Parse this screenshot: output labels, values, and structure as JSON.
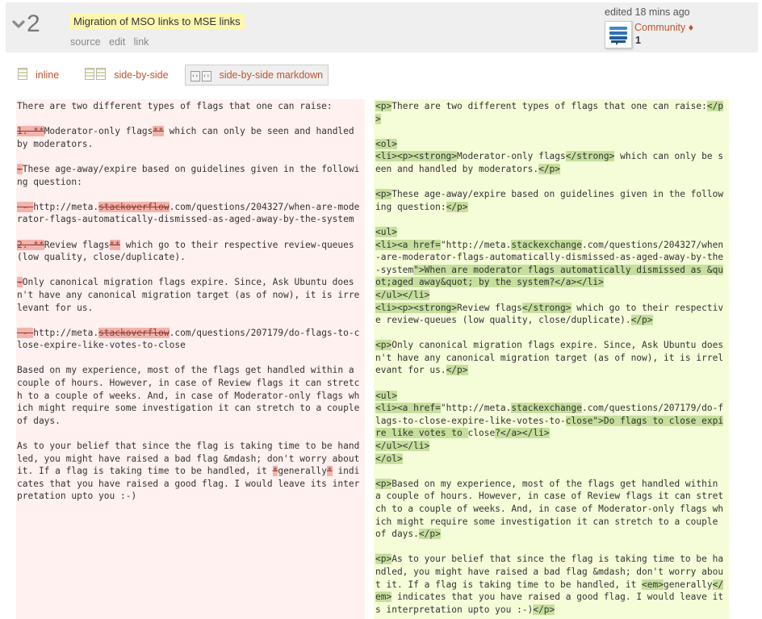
{
  "revision": {
    "number": "2",
    "title": "Migration of MSO links to MSE links",
    "links": [
      "source",
      "edit",
      "link"
    ]
  },
  "editor": {
    "edited_text": "edited 18 mins ago",
    "name": "Community",
    "diamond": "♦",
    "reputation": "1"
  },
  "tabs": [
    "inline",
    "side-by-side",
    "side-by-side markdown"
  ],
  "colors": {
    "link": "#c0532c",
    "deleted_bg": "#f3b3ab",
    "inserted_bg": "#c6df9d",
    "left_pane": "#fff1ef",
    "right_pane": "#f5fcd8"
  },
  "left_pane": [
    {
      "t": "There are two different types of flags that one can raise:\n\n"
    },
    {
      "t": "1. **",
      "c": "del"
    },
    {
      "t": "Moderator-only flags"
    },
    {
      "t": "**",
      "c": "del"
    },
    {
      "t": " which can only be seen and handled by moderators.\n\n"
    },
    {
      "t": "-",
      "c": "del"
    },
    {
      "t": "These age-away/expire based on guidelines given in the following question:\n\n"
    },
    {
      "t": " - ",
      "c": "del"
    },
    {
      "t": "http://meta."
    },
    {
      "t": "stackoverflow",
      "c": "del"
    },
    {
      "t": ".com/questions/204327/when-are-moderator-flags-automatically-dismissed-as-aged-away-by-the-system\n\n"
    },
    {
      "t": "2. **",
      "c": "del"
    },
    {
      "t": "Review flags"
    },
    {
      "t": "**",
      "c": "del"
    },
    {
      "t": " which go to their respective review-queues (low quality, close/duplicate).\n\n"
    },
    {
      "t": "-",
      "c": "del"
    },
    {
      "t": "Only canonical migration flags expire. Since, Ask Ubuntu doesn't have any canonical migration target (as of now), it is irrelevant for us.\n\n"
    },
    {
      "t": " - ",
      "c": "del"
    },
    {
      "t": "http://meta."
    },
    {
      "t": "stackoverflow",
      "c": "del"
    },
    {
      "t": ".com/questions/207179/do-flags-to-close-expire-like-votes-to-close\n\nBased on my experience, most of the flags get handled within a couple of hours. However, in case of Review flags it can stretch to a couple of weeks. And, in case of Moderator-only flags which might require some investigation it can stretch to a couple of days.\n\nAs to your belief that since the flag is taking time to be handled, you might have raised a bad flag &mdash; don't worry about it. If a flag is taking time to be handled, it "
    },
    {
      "t": "*",
      "c": "del"
    },
    {
      "t": "generally"
    },
    {
      "t": "*",
      "c": "del"
    },
    {
      "t": " indicates that you have raised a good flag. I would leave its interpretation upto you :-)"
    }
  ],
  "right_pane": [
    {
      "t": "<p>",
      "c": "ins"
    },
    {
      "t": "There are two different types of flags that one can raise:"
    },
    {
      "t": "</p>",
      "c": "ins"
    },
    {
      "t": "\n\n"
    },
    {
      "t": "<ol>",
      "c": "ins"
    },
    {
      "t": "\n"
    },
    {
      "t": "<li><p><strong>",
      "c": "ins"
    },
    {
      "t": "Moderator-only flags"
    },
    {
      "t": "</strong>",
      "c": "ins"
    },
    {
      "t": " which can only be seen and handled by moderators."
    },
    {
      "t": "</p>",
      "c": "ins"
    },
    {
      "t": "\n\n"
    },
    {
      "t": "<p>",
      "c": "ins"
    },
    {
      "t": "These age-away/expire based on guidelines given in the following question:"
    },
    {
      "t": "</p>",
      "c": "ins"
    },
    {
      "t": "\n\n"
    },
    {
      "t": "<ul>",
      "c": "ins"
    },
    {
      "t": "\n"
    },
    {
      "t": "<li><a href=",
      "c": "ins"
    },
    {
      "t": "\"http://meta."
    },
    {
      "t": "stackexchange",
      "c": "ins"
    },
    {
      "t": ".com/questions/204327/when-are-moderator-flags-automatically-dismissed-as-aged-away-by-the-system"
    },
    {
      "t": "\">When are moderator flags automatically dismissed as &quot;aged away&quot; by the system?</a></li>",
      "c": "ins"
    },
    {
      "t": "\n"
    },
    {
      "t": "</ul></li>",
      "c": "ins"
    },
    {
      "t": "\n"
    },
    {
      "t": "<li><p><strong>",
      "c": "ins"
    },
    {
      "t": "Review flags"
    },
    {
      "t": "</strong>",
      "c": "ins"
    },
    {
      "t": " which go to their respective review-queues (low quality, close/duplicate)."
    },
    {
      "t": "</p>",
      "c": "ins"
    },
    {
      "t": "\n\n"
    },
    {
      "t": "<p>",
      "c": "ins"
    },
    {
      "t": "Only canonical migration flags expire. Since, Ask Ubuntu doesn't have any canonical migration target (as of now), it is irrelevant for us."
    },
    {
      "t": "</p>",
      "c": "ins"
    },
    {
      "t": "\n\n"
    },
    {
      "t": "<ul>",
      "c": "ins"
    },
    {
      "t": "\n"
    },
    {
      "t": "<li><a href=",
      "c": "ins"
    },
    {
      "t": "\"http://meta."
    },
    {
      "t": "stackexchange",
      "c": "ins"
    },
    {
      "t": ".com/questions/207179/do-flags-to-close-expire-like-votes-to-"
    },
    {
      "t": "close\">Do flags to close expire like votes to ",
      "c": "ins"
    },
    {
      "t": "close"
    },
    {
      "t": "?</a></li>",
      "c": "ins"
    },
    {
      "t": "\n"
    },
    {
      "t": "</ul></li>",
      "c": "ins"
    },
    {
      "t": "\n"
    },
    {
      "t": "</ol>",
      "c": "ins"
    },
    {
      "t": "\n\n"
    },
    {
      "t": "<p>",
      "c": "ins"
    },
    {
      "t": "Based on my experience, most of the flags get handled within a couple of hours. However, in case of Review flags it can stretch to a couple of weeks. And, in case of Moderator-only flags which might require some investigation it can stretch to a couple of days."
    },
    {
      "t": "</p>",
      "c": "ins"
    },
    {
      "t": "\n\n"
    },
    {
      "t": "<p>",
      "c": "ins"
    },
    {
      "t": "As to your belief that since the flag is taking time to be handled, you might have raised a bad flag &mdash; don't worry about it. If a flag is taking time to be handled, it "
    },
    {
      "t": "<em>",
      "c": "ins"
    },
    {
      "t": "generally"
    },
    {
      "t": "</em>",
      "c": "ins"
    },
    {
      "t": " indicates that you have raised a good flag. I would leave its interpretation upto you :-)"
    },
    {
      "t": "</p>",
      "c": "ins"
    }
  ]
}
